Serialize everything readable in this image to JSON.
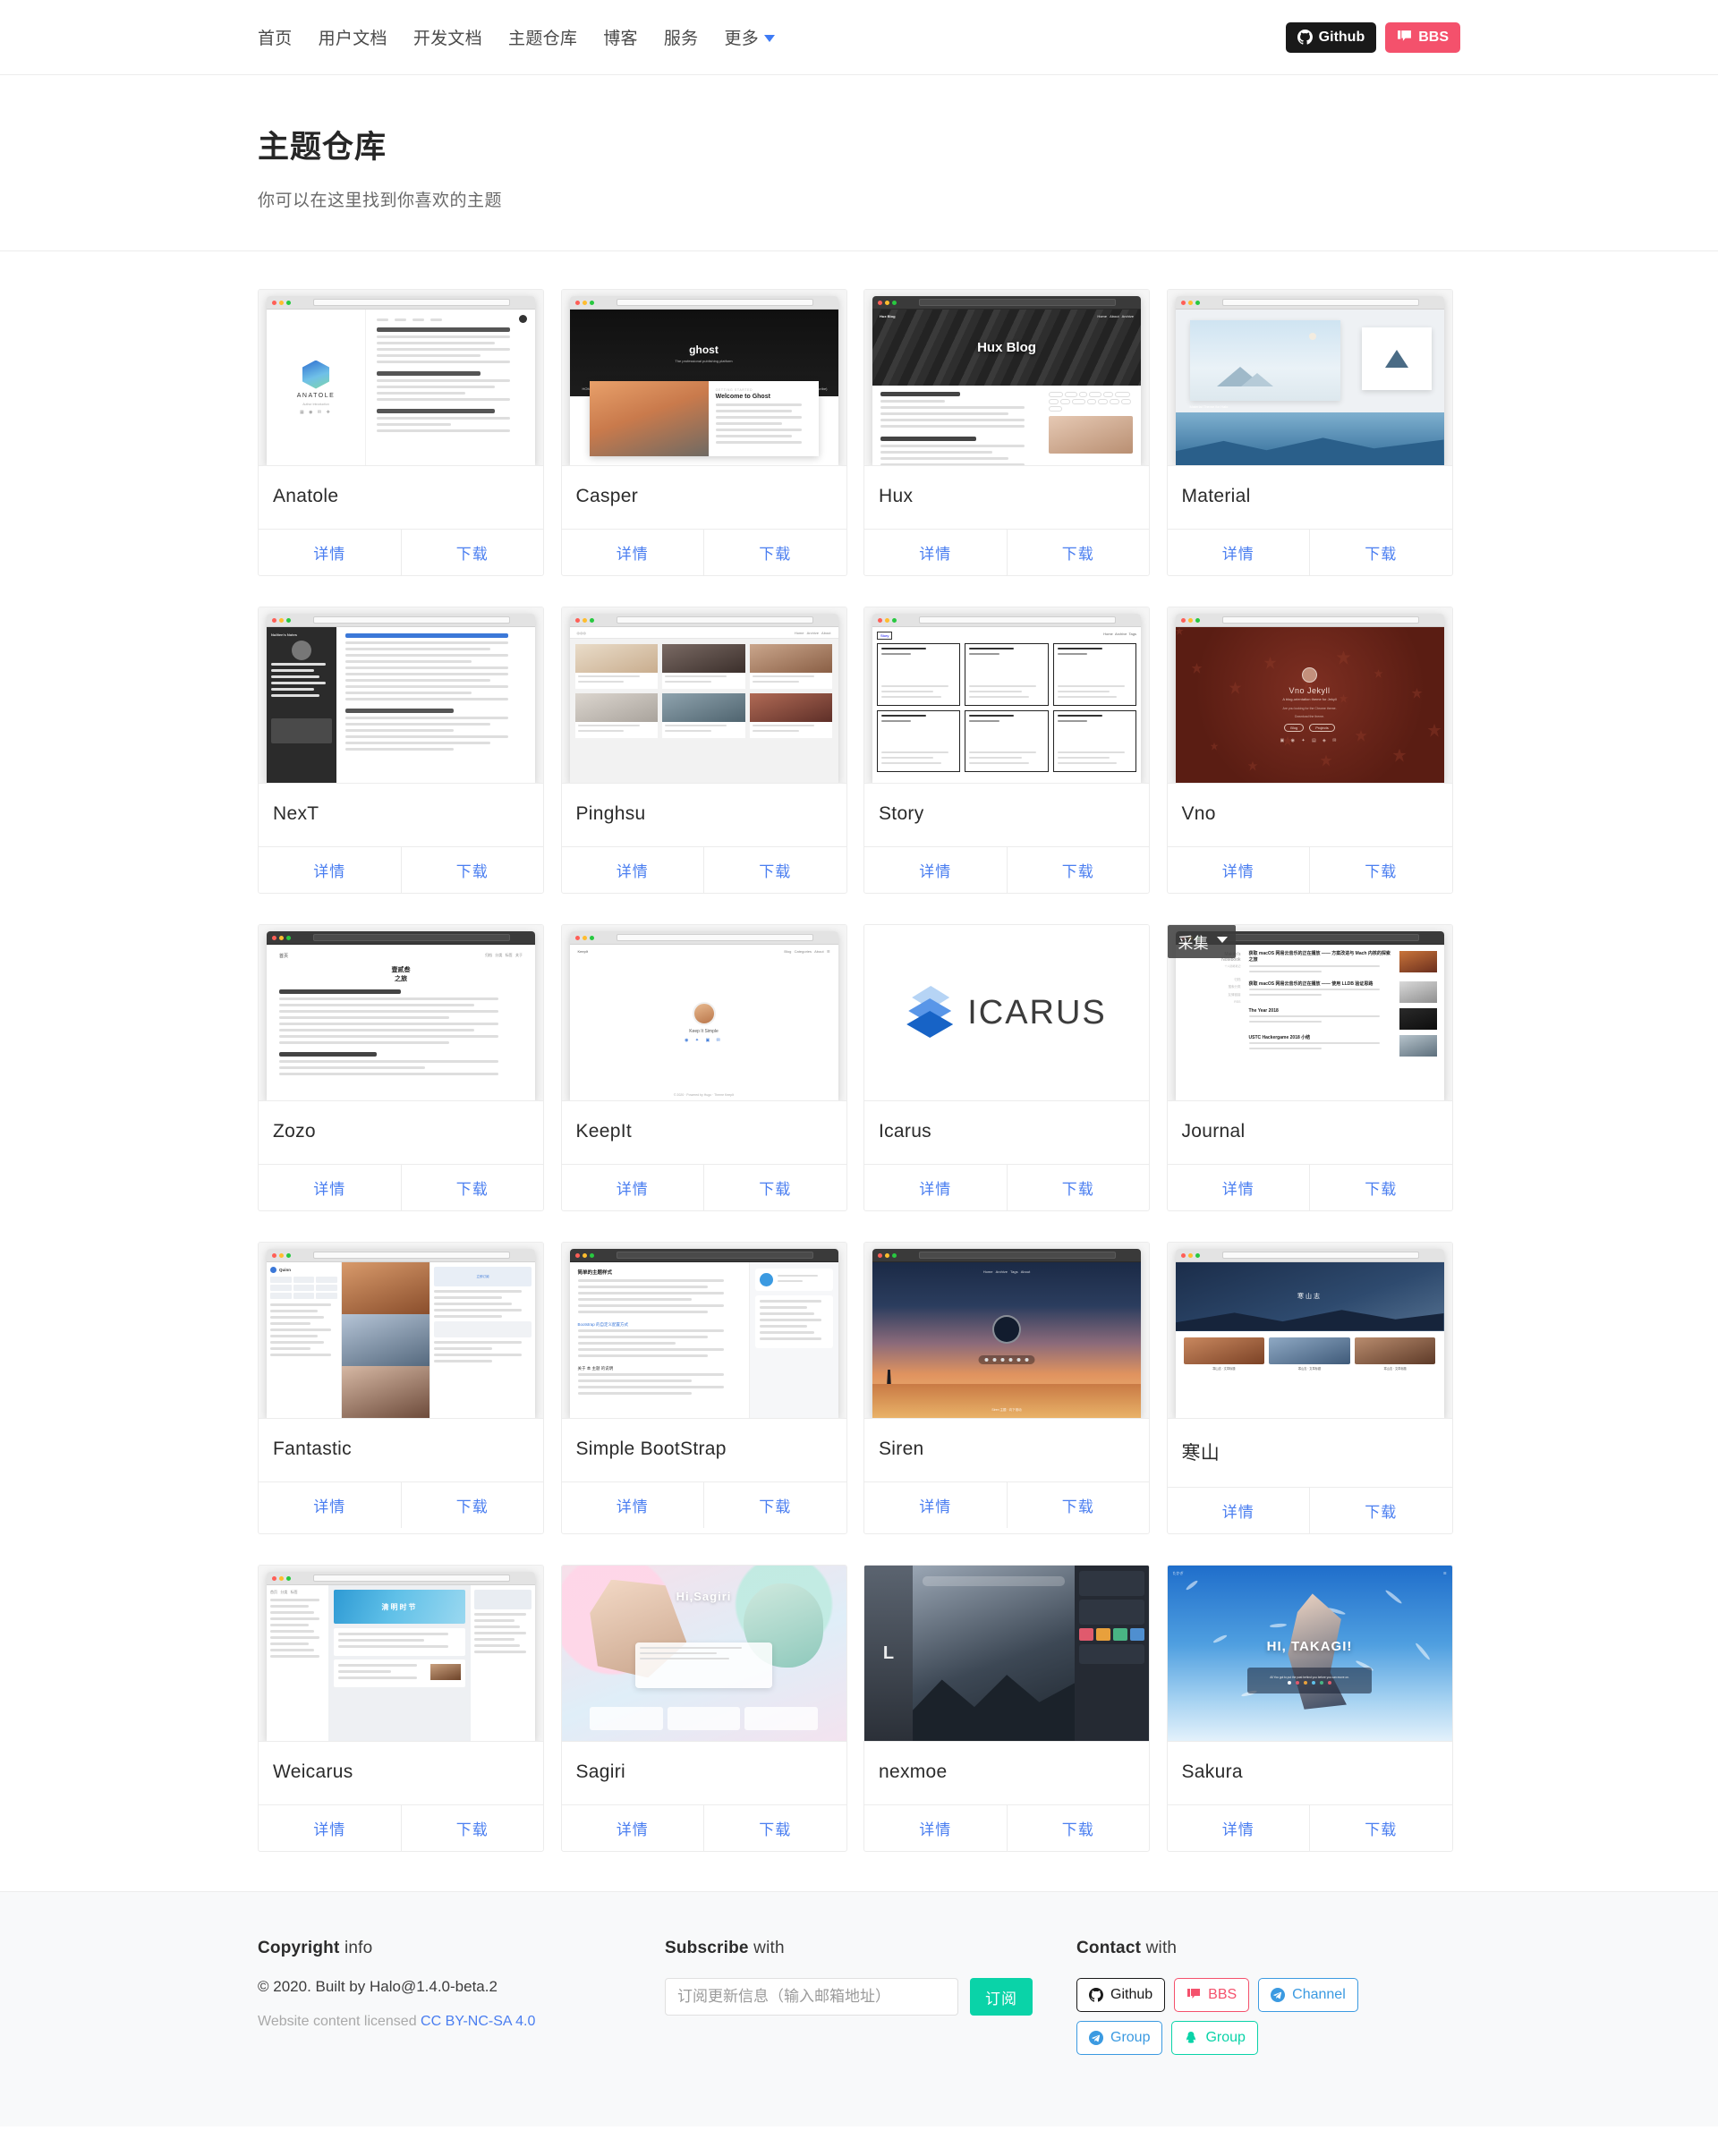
{
  "nav": {
    "links": [
      {
        "label": "首页",
        "name": "nav-home"
      },
      {
        "label": "用户文档",
        "name": "nav-user-docs"
      },
      {
        "label": "开发文档",
        "name": "nav-dev-docs"
      },
      {
        "label": "主题仓库",
        "name": "nav-themes"
      },
      {
        "label": "博客",
        "name": "nav-blog"
      },
      {
        "label": "服务",
        "name": "nav-service"
      }
    ],
    "more_label": "更多",
    "github_label": "Github",
    "bbs_label": "BBS"
  },
  "header": {
    "title": "主题仓库",
    "subtitle": "你可以在这里找到你喜欢的主题"
  },
  "card_actions": {
    "detail": "详情",
    "download": "下载"
  },
  "themes": [
    {
      "name": "Anatole",
      "style": "anatole",
      "overlay": ""
    },
    {
      "name": "Casper",
      "style": "casper",
      "overlay": ""
    },
    {
      "name": "Hux",
      "style": "hux",
      "overlay": ""
    },
    {
      "name": "Material",
      "style": "material",
      "overlay": ""
    },
    {
      "name": "NexT",
      "style": "next",
      "overlay": ""
    },
    {
      "name": "Pinghsu",
      "style": "pinghsu",
      "overlay": ""
    },
    {
      "name": "Story",
      "style": "story",
      "overlay": ""
    },
    {
      "name": "Vno",
      "style": "vno",
      "overlay": ""
    },
    {
      "name": "Zozo",
      "style": "zozo",
      "overlay": ""
    },
    {
      "name": "KeepIt",
      "style": "keepit",
      "overlay": ""
    },
    {
      "name": "Icarus",
      "style": "icarus",
      "overlay": ""
    },
    {
      "name": "Journal",
      "style": "journal",
      "overlay": "采集"
    },
    {
      "name": "Fantastic",
      "style": "fantastic",
      "overlay": ""
    },
    {
      "name": "Simple BootStrap",
      "style": "simple",
      "overlay": ""
    },
    {
      "name": "Siren",
      "style": "siren",
      "overlay": ""
    },
    {
      "name": "寒山",
      "style": "hanshan",
      "overlay": ""
    },
    {
      "name": "Weicarus",
      "style": "weicarus",
      "overlay": ""
    },
    {
      "name": "Sagiri",
      "style": "sagiri",
      "overlay": ""
    },
    {
      "name": "nexmoe",
      "style": "nexmoe",
      "overlay": ""
    },
    {
      "name": "Sakura",
      "style": "sakura",
      "overlay": ""
    }
  ],
  "thumb_text": {
    "anatole": "ANATOLE",
    "casper": "ghost",
    "hux": "Hux Blog",
    "icarus": "ICARUS",
    "vno": "Vno Jekyll",
    "vno_sub": "A blog-orientation theme for Jekyll",
    "sakura": "HI, TAKAGI!",
    "sagiri": "Hi,Sagiri",
    "hanshan": "寒山志"
  },
  "footer": {
    "copyright_head_bold": "Copyright",
    "copyright_head_rest": " info",
    "built_by": "© 2020. Built by Halo@1.4.0-beta.2",
    "license_prefix": "Website content licensed ",
    "license_link": "CC BY-NC-SA 4.0",
    "subscribe_head_bold": "Subscribe",
    "subscribe_head_rest": " with",
    "subscribe_placeholder": "订阅更新信息（输入邮箱地址）",
    "subscribe_button": "订阅",
    "contact_head_bold": "Contact",
    "contact_head_rest": " with",
    "contacts": [
      {
        "label": "Github",
        "kind": "gh"
      },
      {
        "label": "BBS",
        "kind": "bbs"
      },
      {
        "label": "Channel",
        "kind": "tg"
      },
      {
        "label": "Group",
        "kind": "tg"
      },
      {
        "label": "Group",
        "kind": "qq"
      }
    ]
  },
  "colors": {
    "accent_blue": "#4a7ef0",
    "brand_pink": "#f4516c",
    "brand_black": "#191919",
    "brand_teal": "#0ad3a8",
    "telegram_blue": "#3b9ae1"
  }
}
